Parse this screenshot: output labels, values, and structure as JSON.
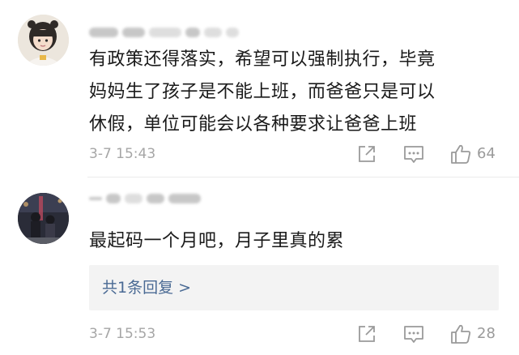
{
  "comments": [
    {
      "text_lines": [
        "有政策还得落实，希望可以强制执行，毕竟",
        "妈妈生了孩子是不能上班，而爸爸只是可以",
        "休假，单位可能会以各种要求让爸爸上班"
      ],
      "timestamp": "3-7 15:43",
      "likes": "64"
    },
    {
      "text_lines": [
        "最起码一个月吧，月子里真的累"
      ],
      "reply_link": "共1条回复 >",
      "timestamp": "3-7 15:53",
      "likes": "28"
    }
  ],
  "colors": {
    "text": "#1a1a1a",
    "meta": "#a6a6a6",
    "link": "#4a6a94",
    "reply_bg": "#f3f3f3",
    "icon": "#9a9a9a"
  },
  "icons": [
    "share-icon",
    "comment-icon",
    "thumbs-up-icon"
  ]
}
